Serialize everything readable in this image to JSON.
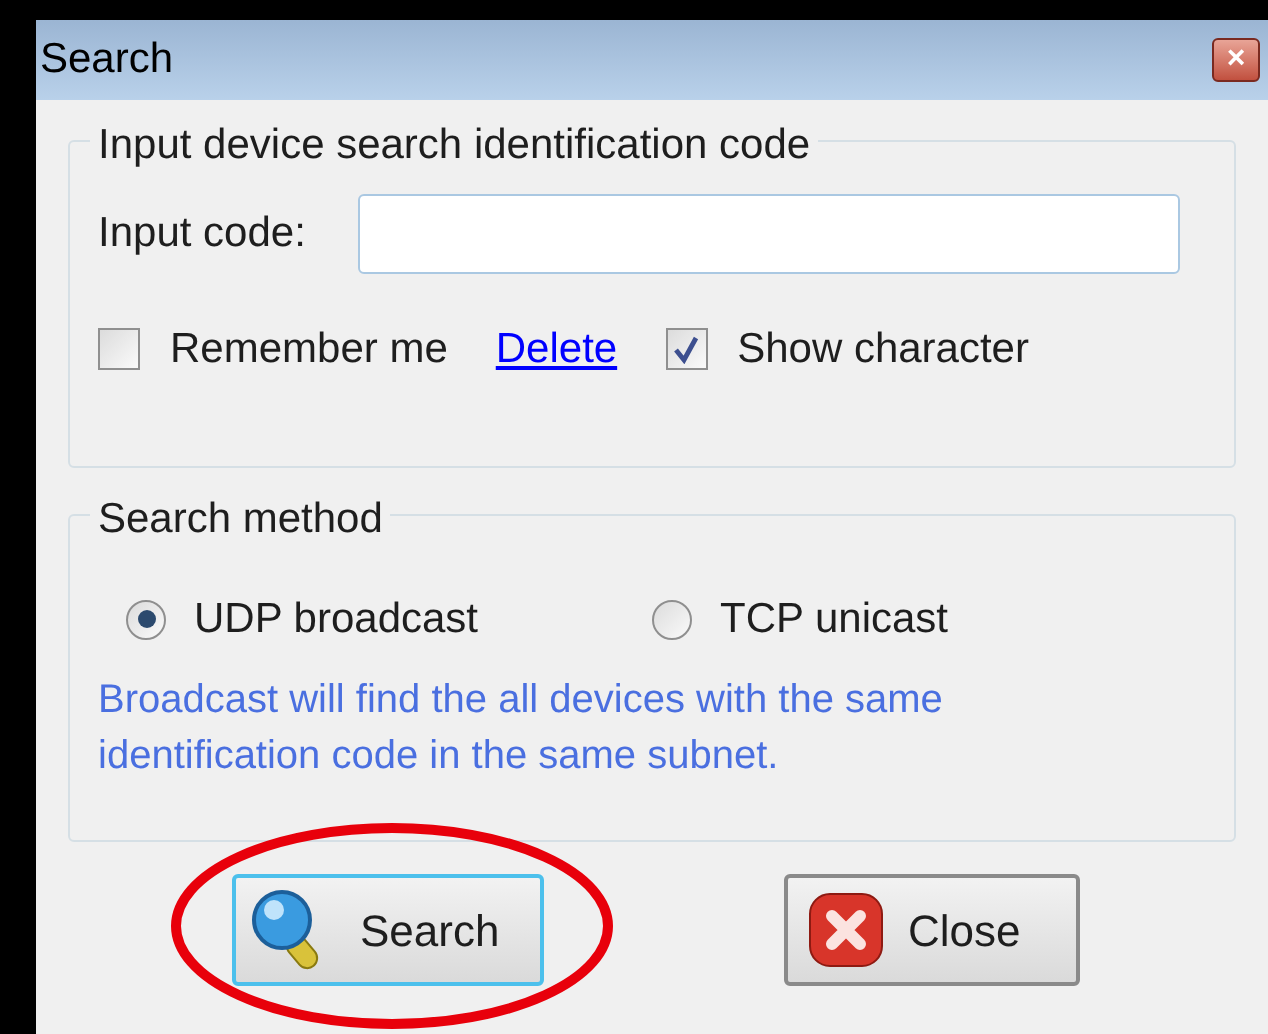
{
  "window": {
    "title": "Search",
    "close_icon": "×"
  },
  "identification": {
    "legend": "Input device search identification code",
    "code_label": "Input code:",
    "remember": {
      "label": "Remember me",
      "checked": false
    },
    "delete_link": "Delete",
    "show_character": {
      "label": "Show character",
      "checked": true
    }
  },
  "search_method": {
    "legend": "Search method",
    "options": [
      {
        "label": "UDP broadcast",
        "selected": true
      },
      {
        "label": "TCP unicast",
        "selected": false
      }
    ],
    "note": "Broadcast will find the all devices with the same identification code in the same subnet."
  },
  "buttons": [
    {
      "kind": "search",
      "label": "Search",
      "highlighted": true
    },
    {
      "kind": "close",
      "label": "Close",
      "highlighted": false
    }
  ]
}
